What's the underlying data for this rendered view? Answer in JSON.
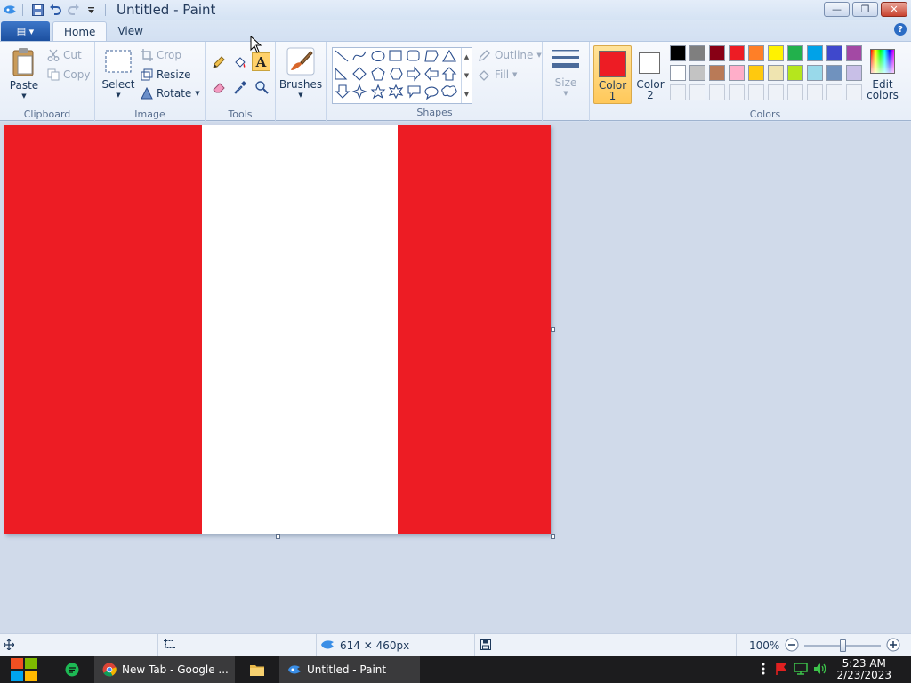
{
  "window": {
    "title": "Untitled - Paint",
    "minimize_label": "—",
    "restore_label": "❐",
    "close_label": "✕"
  },
  "tabs": {
    "file_label": "▤ ▾",
    "home": "Home",
    "view": "View",
    "help": "?"
  },
  "clipboard": {
    "paste": "Paste",
    "cut": "Cut",
    "copy": "Copy",
    "group": "Clipboard"
  },
  "image": {
    "select": "Select",
    "crop": "Crop",
    "resize": "Resize",
    "rotate": "Rotate",
    "group": "Image"
  },
  "tools": {
    "group": "Tools",
    "text_tool": "A"
  },
  "brushes": {
    "label": "Brushes"
  },
  "shapes": {
    "outline": "Outline",
    "fill": "Fill",
    "group": "Shapes"
  },
  "size": {
    "label": "Size"
  },
  "colors": {
    "color1_line1": "Color",
    "color1_line2": "1",
    "color2_line1": "Color",
    "color2_line2": "2",
    "edit_line1": "Edit",
    "edit_line2": "colors",
    "group": "Colors",
    "color1": "#ed1c24",
    "color2": "#ffffff",
    "palette_row1": [
      "#000000",
      "#7f7f7f",
      "#880015",
      "#ed1c24",
      "#ff7f27",
      "#fff200",
      "#22b14c",
      "#00a2e8",
      "#3f48cc",
      "#a349a4"
    ],
    "palette_row2": [
      "#ffffff",
      "#c3c3c3",
      "#b97a57",
      "#ffaec9",
      "#ffc90e",
      "#efe4b0",
      "#b5e61d",
      "#99d9ea",
      "#7092be",
      "#c8bfe7"
    ]
  },
  "canvas": {
    "stripe_colors": [
      "#ed1c24",
      "#ffffff",
      "#ed1c24"
    ]
  },
  "status": {
    "dimensions": "614 ✕ 460px",
    "zoom": "100%"
  },
  "taskbar": {
    "chrome_label": "New Tab - Google ...",
    "paint_label": "Untitled - Paint",
    "time": "5:23 AM",
    "date": "2/23/2023"
  }
}
